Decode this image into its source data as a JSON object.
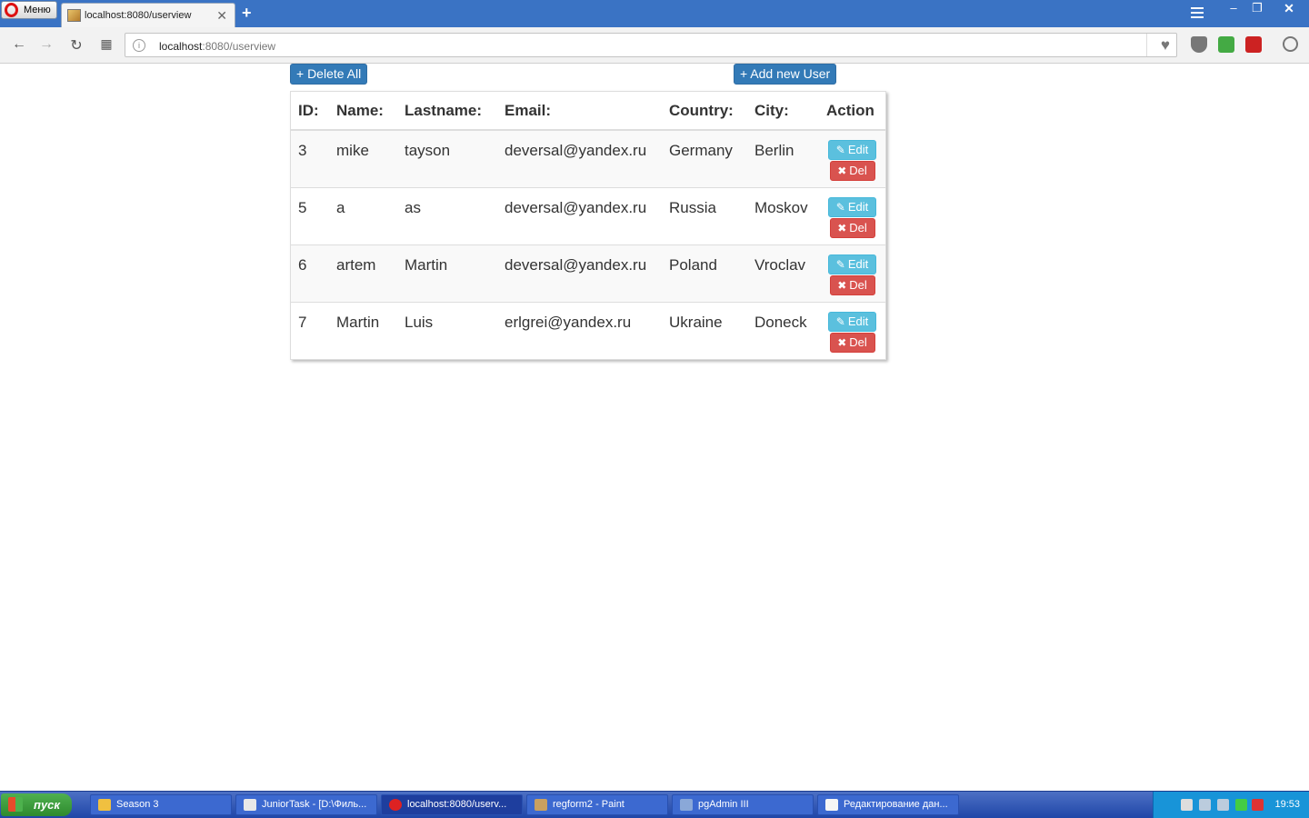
{
  "browser": {
    "menu_label": "Меню",
    "tab_title": "localhost:8080/userview",
    "new_tab": "+",
    "url_host": "localhost",
    "url_rest": ":8080/userview"
  },
  "page": {
    "delete_all_label": "+ Delete All",
    "add_user_label": "+ Add new User",
    "columns": [
      "ID:",
      "Name:",
      "Lastname:",
      "Email:",
      "Country:",
      "City:",
      "Action"
    ],
    "rows": [
      {
        "id": "3",
        "name": "mike",
        "lastname": "tayson",
        "email": "deversal@yandex.ru",
        "country": "Germany",
        "city": "Berlin"
      },
      {
        "id": "5",
        "name": "a",
        "lastname": "as",
        "email": "deversal@yandex.ru",
        "country": "Russia",
        "city": "Moskov"
      },
      {
        "id": "6",
        "name": "artem",
        "lastname": "Martin",
        "email": "deversal@yandex.ru",
        "country": "Poland",
        "city": "Vroclav"
      },
      {
        "id": "7",
        "name": "Martin",
        "lastname": "Luis",
        "email": "erlgrei@yandex.ru",
        "country": "Ukraine",
        "city": "Doneck"
      }
    ],
    "edit_label": "Edit",
    "del_label": "Del"
  },
  "taskbar": {
    "start_label": "пуск",
    "tasks": [
      {
        "label": "Season 3"
      },
      {
        "label": "JuniorTask - [D:\\Филь..."
      },
      {
        "label": "localhost:8080/userv..."
      },
      {
        "label": "regform2 - Paint"
      },
      {
        "label": "pgAdmin III"
      },
      {
        "label": "Редактирование дан..."
      }
    ],
    "clock": "19:53"
  },
  "colors": {
    "primary": "#337ab7",
    "info": "#5bc0de",
    "danger": "#d9534f",
    "titlebar": "#3a73c4"
  }
}
